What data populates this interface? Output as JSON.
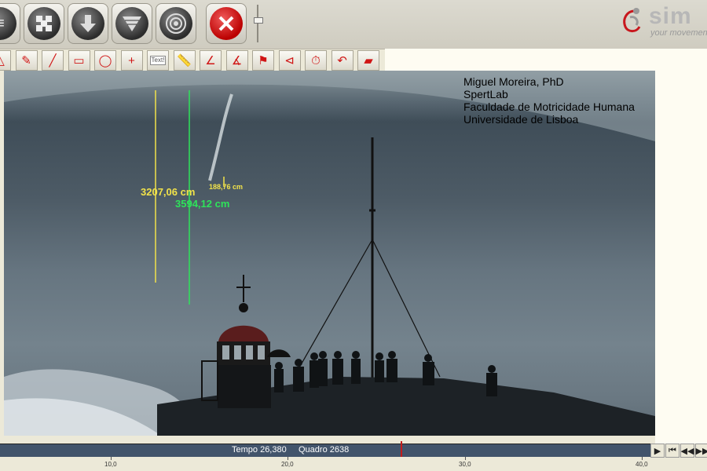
{
  "toolbar": {
    "big_buttons": [
      "menu-icon",
      "checker-icon",
      "download-arrow-icon",
      "funnel-icon",
      "target-icon",
      "stop-icon"
    ],
    "accent": "#d01515"
  },
  "logo": {
    "brand": "sim",
    "tagline": "your movement"
  },
  "tools": [
    {
      "icon": "triangle-icon",
      "glyph": "△"
    },
    {
      "icon": "pen-icon",
      "glyph": "✎"
    },
    {
      "icon": "line-icon",
      "glyph": "╱"
    },
    {
      "icon": "rectangle-icon",
      "glyph": "▭"
    },
    {
      "icon": "ellipse-icon",
      "glyph": "◯"
    },
    {
      "icon": "crosshair-icon",
      "glyph": "+"
    },
    {
      "icon": "text-icon",
      "glyph": "Text!"
    },
    {
      "icon": "ruler-icon",
      "glyph": "📏"
    },
    {
      "icon": "angle-icon",
      "glyph": "∠"
    },
    {
      "icon": "angle-arc-icon",
      "glyph": "∡"
    },
    {
      "icon": "flag-angle-icon",
      "glyph": "⚑"
    },
    {
      "icon": "horizontal-angle-icon",
      "glyph": "⊲"
    },
    {
      "icon": "stopwatch-icon",
      "glyph": "⏱"
    },
    {
      "icon": "undo-icon",
      "glyph": "↶"
    },
    {
      "icon": "eraser-icon",
      "glyph": "▰"
    }
  ],
  "video": {
    "credits": [
      "Miguel Moreira, PhD",
      "SpertLab",
      "Faculdade de Motricidade Humana",
      "Universidade de Lisboa"
    ],
    "measurements": [
      {
        "value": "3207,06 cm",
        "color": "#f1e24a"
      },
      {
        "value": "3594,12 cm",
        "color": "#2ee35a"
      },
      {
        "value": "188,76 cm",
        "color": "#f1e24a"
      }
    ]
  },
  "timeline": {
    "time_label": "Tempo 26,380",
    "frame_label": "Quadro 2638",
    "ticks": [
      "10,0",
      "20,0",
      "30,0",
      "40,0"
    ]
  },
  "transport": [
    {
      "icon": "play-icon",
      "glyph": "▶"
    },
    {
      "icon": "skip-start-icon",
      "glyph": "⏮"
    },
    {
      "icon": "rewind-icon",
      "glyph": "◀◀"
    },
    {
      "icon": "skip-end-icon",
      "glyph": "▶▶"
    }
  ]
}
